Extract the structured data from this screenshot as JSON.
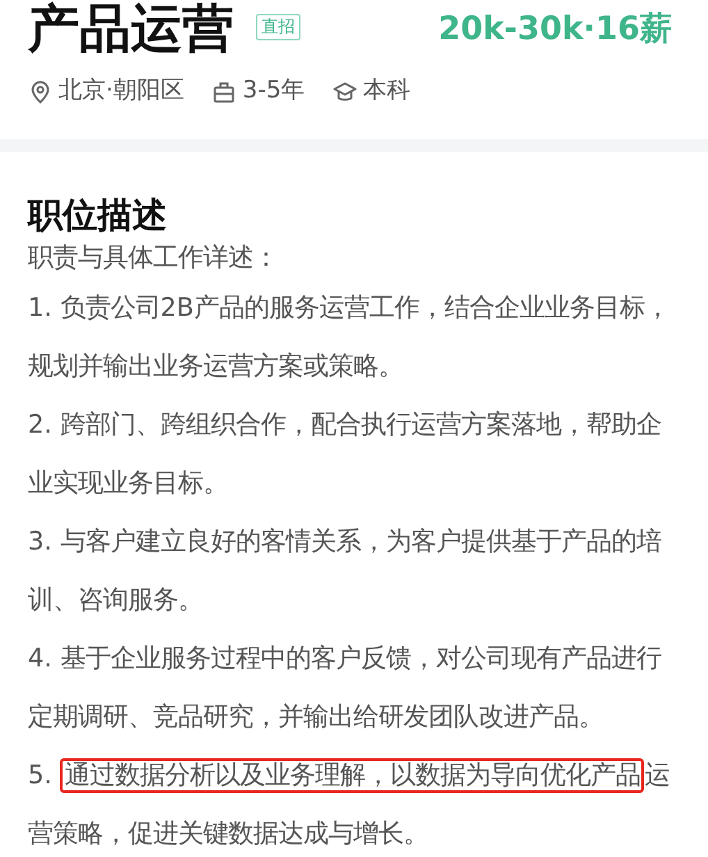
{
  "job": {
    "title": "产品运营",
    "badge": "直招",
    "salary": "20k-30k·16薪",
    "meta": [
      {
        "kind": "location",
        "text": "北京·朝阳区"
      },
      {
        "kind": "experience",
        "text": "3-5年"
      },
      {
        "kind": "education",
        "text": "本科"
      }
    ]
  },
  "description": {
    "heading": "职位描述",
    "intro": "职责与具体工作详述：",
    "items": [
      {
        "kind": "plain",
        "number": "1.",
        "text": "负责公司2B产品的服务运营工作，结合企业业务目标，规划并输出业务运营方案或策略。"
      },
      {
        "kind": "plain",
        "number": "2.",
        "text": "跨部门、跨组织合作，配合执行运营方案落地，帮助企业实现业务目标。"
      },
      {
        "kind": "plain",
        "number": "3.",
        "text": "与客户建立良好的客情关系，为客户提供基于产品的培训、咨询服务。"
      },
      {
        "kind": "plain",
        "number": "4.",
        "text": "基于企业服务过程中的客户反馈，对公司现有产品进行定期调研、竞品研究，并输出给研发团队改进产品。"
      },
      {
        "kind": "highlighted",
        "number": "5.",
        "highlight": "通过数据分析以及业务理解，以数据为导向优化产品",
        "text": "运营策略，促进关键数据达成与增长。"
      }
    ]
  }
}
